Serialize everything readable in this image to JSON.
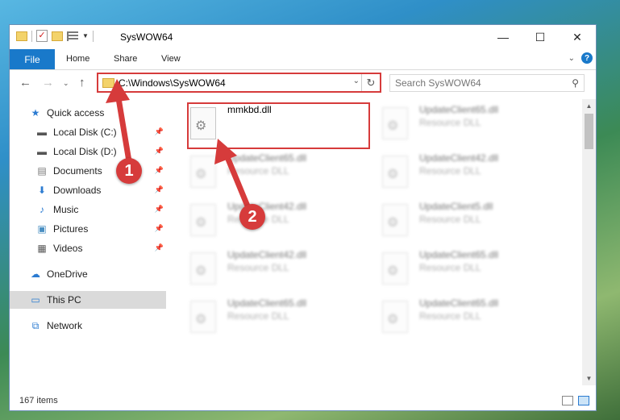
{
  "window": {
    "title": "SysWOW64",
    "caption": {
      "minimize": "—",
      "maximize": "☐",
      "close": "✕"
    }
  },
  "ribbon": {
    "file": "File",
    "tabs": [
      "Home",
      "Share",
      "View"
    ],
    "help": "?"
  },
  "address": {
    "path": "C:\\Windows\\SysWOW64",
    "search_placeholder": "Search SysWOW64"
  },
  "sidebar": {
    "items": [
      {
        "label": "Quick access",
        "icon": "star-icon"
      },
      {
        "label": "Local Disk (C:)",
        "icon": "drive-icon"
      },
      {
        "label": "Local Disk (D:)",
        "icon": "drive-icon"
      },
      {
        "label": "Documents",
        "icon": "documents-icon"
      },
      {
        "label": "Downloads",
        "icon": "downloads-icon"
      },
      {
        "label": "Music",
        "icon": "music-icon"
      },
      {
        "label": "Pictures",
        "icon": "pictures-icon"
      },
      {
        "label": "Videos",
        "icon": "videos-icon"
      },
      {
        "label": "OneDrive",
        "icon": "cloud-icon"
      },
      {
        "label": "This PC",
        "icon": "computer-icon"
      },
      {
        "label": "Network",
        "icon": "network-icon"
      }
    ]
  },
  "files": [
    {
      "name": "mmkbd.dll",
      "type": ""
    },
    {
      "name": "UpdateClient65.dll",
      "type": "Resource DLL"
    },
    {
      "name": "UpdateClient65.dll",
      "type": "Resource DLL"
    },
    {
      "name": "UpdateClient42.dll",
      "type": "Resource DLL"
    },
    {
      "name": "UpdateClient42.dll",
      "type": "Resource DLL"
    },
    {
      "name": "UpdateClient5.dll",
      "type": "Resource DLL"
    },
    {
      "name": "UpdateClient42.dll",
      "type": "Resource DLL"
    },
    {
      "name": "UpdateClient65.dll",
      "type": "Resource DLL"
    },
    {
      "name": "UpdateClient65.dll",
      "type": "Resource DLL"
    },
    {
      "name": "UpdateClient65.dll",
      "type": "Resource DLL"
    }
  ],
  "status": {
    "items": "167 items"
  },
  "callouts": {
    "one": "1",
    "two": "2"
  },
  "colors": {
    "accent": "#1979ca",
    "annotation": "#d63b3b"
  }
}
